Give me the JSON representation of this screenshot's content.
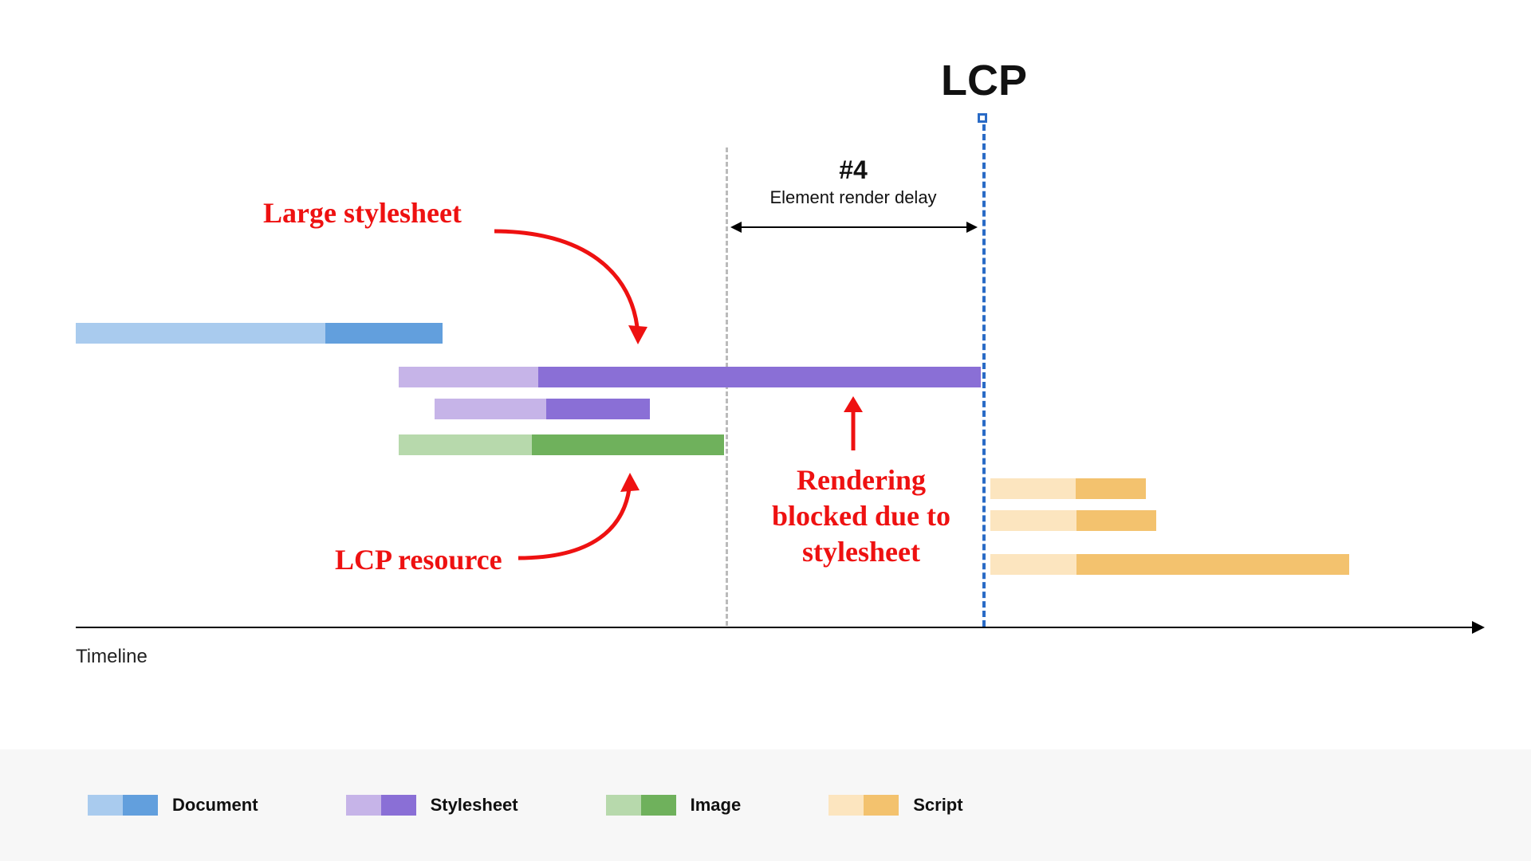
{
  "lcp_label": "LCP",
  "phase": {
    "number": "#4",
    "name": "Element render delay"
  },
  "axis_label": "Timeline",
  "annotations": {
    "large_stylesheet": "Large stylesheet",
    "lcp_resource": "LCP resource",
    "blocked": "Rendering\nblocked due to\nstylesheet"
  },
  "legend": {
    "document": "Document",
    "stylesheet": "Stylesheet",
    "image": "Image",
    "script": "Script"
  },
  "chart_data": {
    "type": "timeline-gantt",
    "x_range": [
      0,
      100
    ],
    "markers": {
      "render_blocked_start": 52,
      "lcp": 72
    },
    "phase_span": {
      "name": "Element render delay",
      "start": 52,
      "end": 72
    },
    "bars": [
      {
        "name": "document",
        "type": "Document",
        "start": 0,
        "end": 28,
        "split": 19
      },
      {
        "name": "large-stylesheet",
        "type": "Stylesheet",
        "start": 24,
        "end": 72,
        "split": 35
      },
      {
        "name": "small-stylesheet",
        "type": "Stylesheet",
        "start": 27,
        "end": 48,
        "split": 38
      },
      {
        "name": "lcp-image",
        "type": "Image",
        "start": 24,
        "end": 52,
        "split": 35
      },
      {
        "name": "script-1",
        "type": "Script",
        "start": 72,
        "end": 85,
        "split": 79
      },
      {
        "name": "script-2",
        "type": "Script",
        "start": 72,
        "end": 86,
        "split": 79
      },
      {
        "name": "script-3",
        "type": "Script",
        "start": 72,
        "end": 100,
        "split": 79
      }
    ],
    "colors": {
      "Document": {
        "light": "#a9cbee",
        "dark": "#629fdd"
      },
      "Stylesheet": {
        "light": "#c6b4e8",
        "dark": "#8a6fd6"
      },
      "Image": {
        "light": "#b7d9ac",
        "dark": "#6fb15c"
      },
      "Script": {
        "light": "#fce5bf",
        "dark": "#f3c26e"
      }
    }
  }
}
